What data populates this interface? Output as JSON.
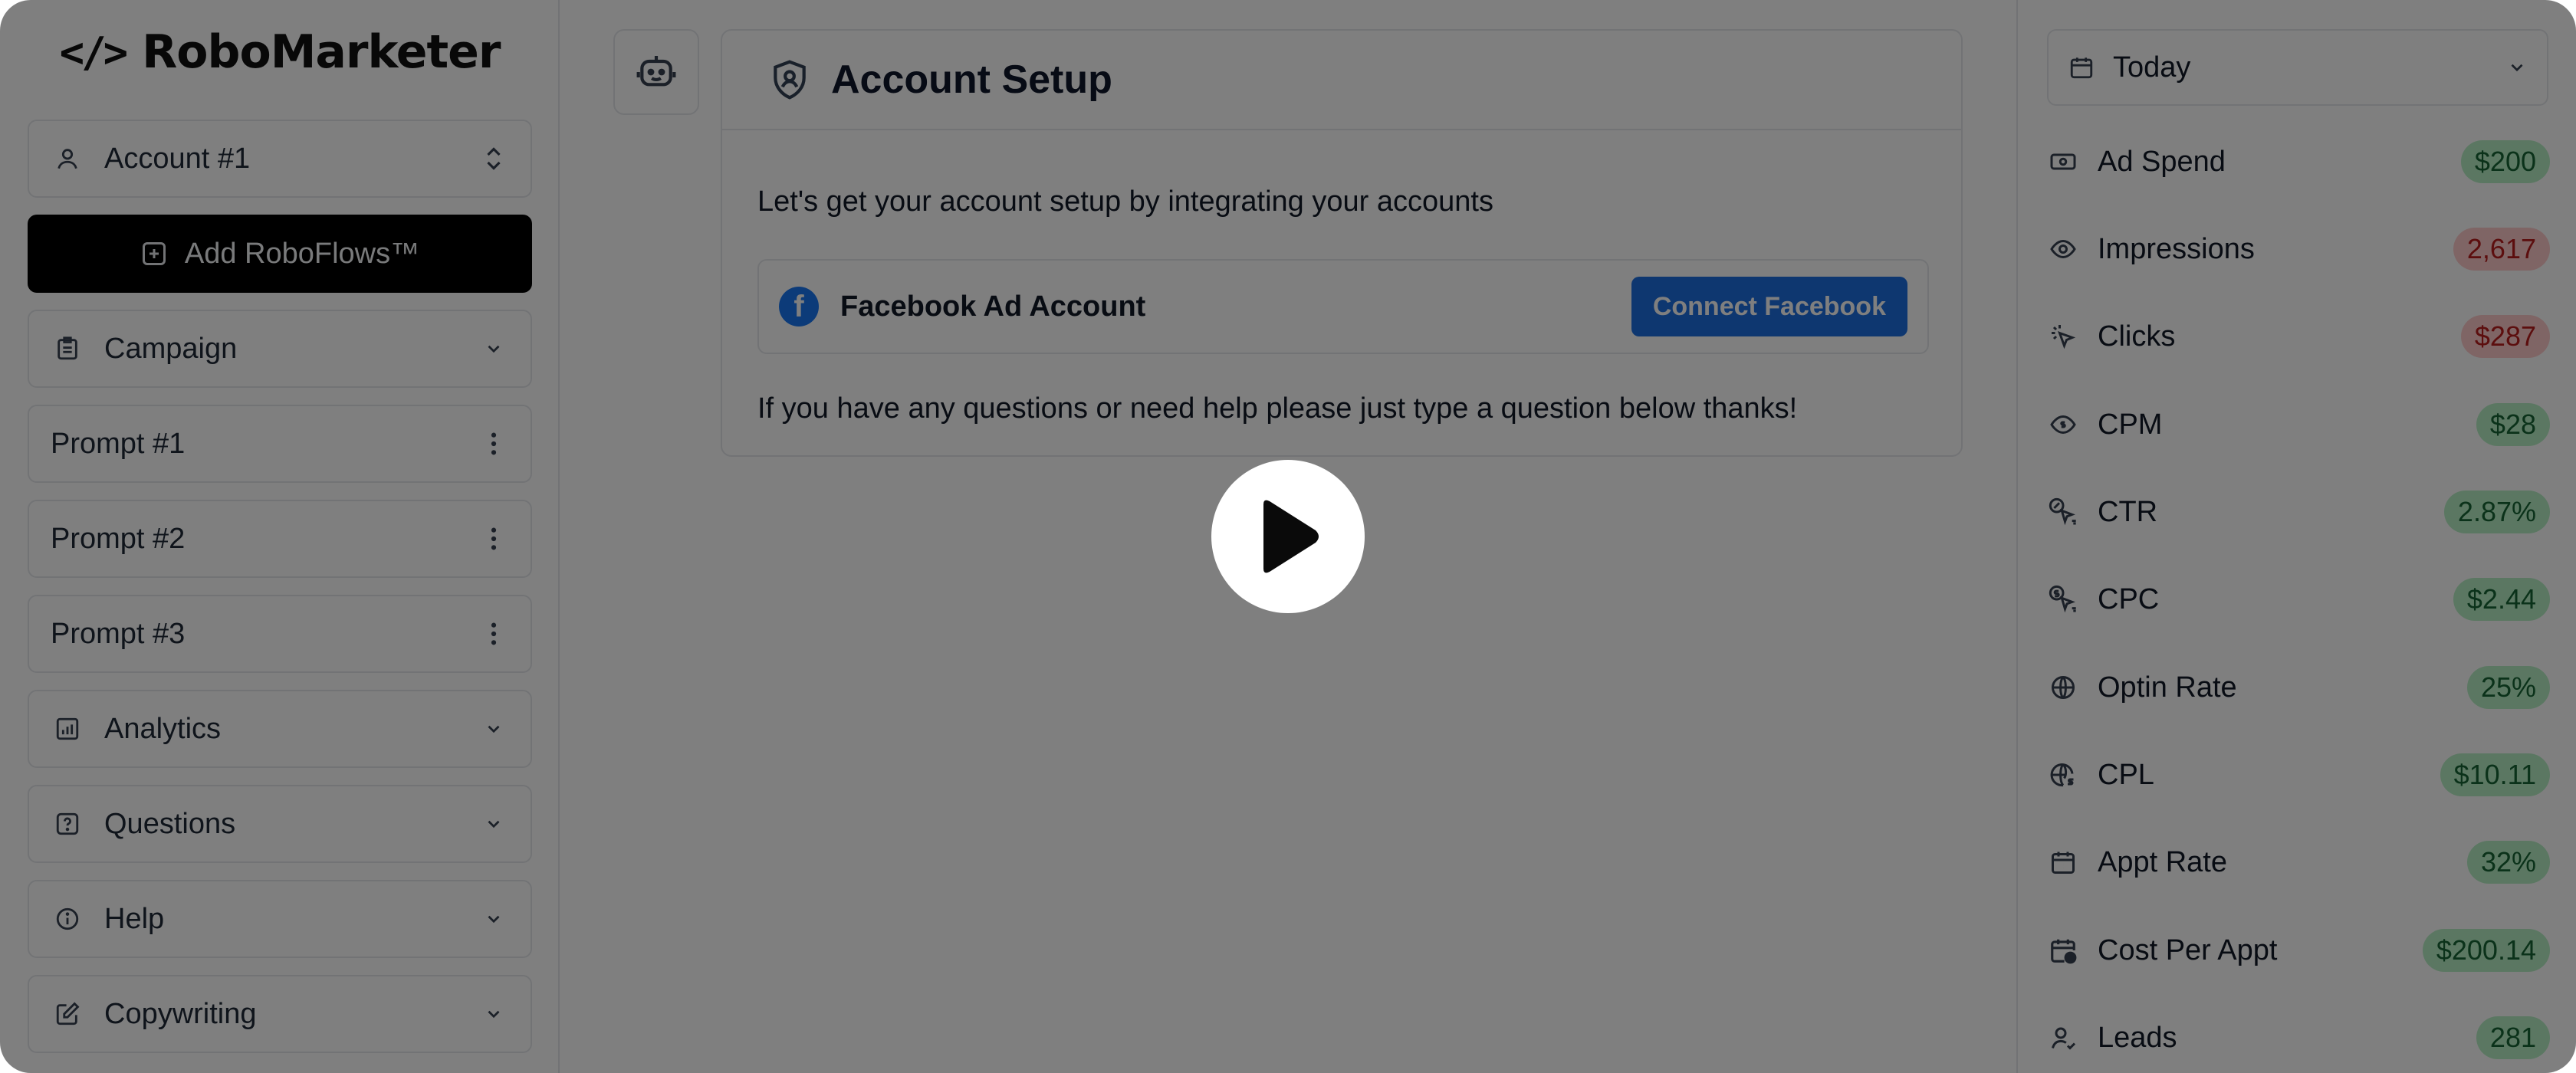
{
  "app": {
    "logo_mark": "</>",
    "logo_text": "RoboMarketer"
  },
  "sidebar": {
    "account_label": "Account #1",
    "add_button_label": "Add RoboFlows™",
    "items": [
      {
        "label": "Campaign",
        "icon": "clipboard-icon",
        "trail": "chevron-down"
      },
      {
        "label": "Prompt #1",
        "icon": "",
        "trail": "kebab"
      },
      {
        "label": "Prompt #2",
        "icon": "",
        "trail": "kebab"
      },
      {
        "label": "Prompt #3",
        "icon": "",
        "trail": "kebab"
      },
      {
        "label": "Analytics",
        "icon": "chart-icon",
        "trail": "chevron-down"
      },
      {
        "label": "Questions",
        "icon": "question-icon",
        "trail": "chevron-down"
      },
      {
        "label": "Help",
        "icon": "info-icon",
        "trail": "chevron-down"
      },
      {
        "label": "Copywriting",
        "icon": "edit-icon",
        "trail": "chevron-down"
      }
    ]
  },
  "main": {
    "card_title": "Account Setup",
    "intro": "Let's get your account setup by integrating your accounts",
    "facebook_label": "Facebook Ad Account",
    "connect_label": "Connect Facebook",
    "help_text": "If you have any questions or need help please just type a question below thanks!"
  },
  "right": {
    "date_label": "Today",
    "metrics": [
      {
        "label": "Ad Spend",
        "value": "$200",
        "status": "good",
        "icon": "money-icon"
      },
      {
        "label": "Impressions",
        "value": "2,617",
        "status": "bad",
        "icon": "eye-icon"
      },
      {
        "label": "Clicks",
        "value": "$287",
        "status": "bad",
        "icon": "cursor-click-icon"
      },
      {
        "label": "CPM",
        "value": "$28",
        "status": "good",
        "icon": "dollar-eye-icon"
      },
      {
        "label": "CTR",
        "value": "2.87%",
        "status": "good",
        "icon": "percent-cursor-icon"
      },
      {
        "label": "CPC",
        "value": "$2.44",
        "status": "good",
        "icon": "dollar-cursor-icon"
      },
      {
        "label": "Optin Rate",
        "value": "25%",
        "status": "good",
        "icon": "globe-icon"
      },
      {
        "label": "CPL",
        "value": "$10.11",
        "status": "good",
        "icon": "globe-dollar-icon"
      },
      {
        "label": "Appt Rate",
        "value": "32%",
        "status": "good",
        "icon": "calendar-icon"
      },
      {
        "label": "Cost Per Appt",
        "value": "$200.14",
        "status": "good",
        "icon": "calendar-dollar-icon"
      },
      {
        "label": "Leads",
        "value": "281",
        "status": "good",
        "icon": "user-icon"
      }
    ]
  },
  "colors": {
    "accent": "#1d6fe0",
    "good": "#b7efc5",
    "bad": "#fecaca",
    "overlay": "rgba(0,0,0,0.5)"
  }
}
